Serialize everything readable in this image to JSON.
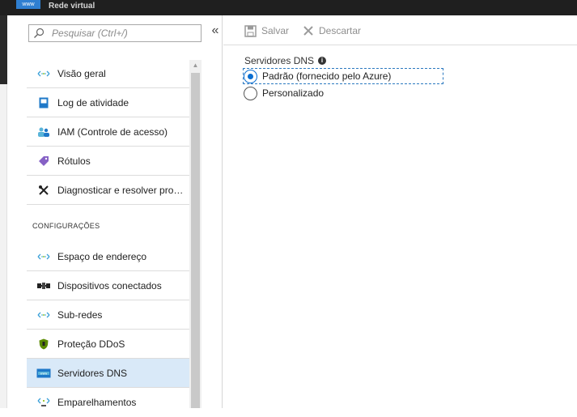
{
  "window": {
    "title": "Rede virtual",
    "logo_text": "www"
  },
  "sidebar": {
    "search_placeholder": "Pesquisar (Ctrl+/)",
    "collapse_glyph": "«",
    "items_top": [
      {
        "label": "Visão geral",
        "icon": "network-arrows-icon"
      },
      {
        "label": "Log de atividade",
        "icon": "log-book-icon"
      },
      {
        "label": "IAM (Controle de acesso)",
        "icon": "people-icon"
      },
      {
        "label": "Rótulos",
        "icon": "tag-icon"
      },
      {
        "label": "Diagnosticar e resolver probl...",
        "icon": "tools-icon"
      }
    ],
    "section_title": "CONFIGURAÇÕES",
    "items_config": [
      {
        "label": "Espaço de endereço",
        "icon": "network-arrows-icon"
      },
      {
        "label": "Dispositivos conectados",
        "icon": "connected-devices-icon"
      },
      {
        "label": "Sub-redes",
        "icon": "network-arrows-icon"
      },
      {
        "label": "Proteção DDoS",
        "icon": "shield-icon"
      },
      {
        "label": "Servidores DNS",
        "icon": "dns-icon",
        "selected": true
      },
      {
        "label": "Emparelhamentos",
        "icon": "peering-icon"
      }
    ]
  },
  "toolbar": {
    "save_label": "Salvar",
    "discard_label": "Descartar"
  },
  "dns": {
    "label": "Servidores DNS",
    "options": [
      {
        "label": "Padrão (fornecido pelo Azure)",
        "selected": true
      },
      {
        "label": "Personalizado",
        "selected": false
      }
    ]
  },
  "colors": {
    "accent": "#0a6ed1",
    "selected_row": "#d9e9f8",
    "topbar": "#1f1f1f"
  }
}
